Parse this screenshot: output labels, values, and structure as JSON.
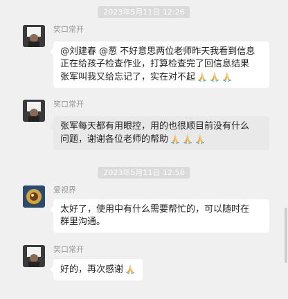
{
  "messages": [
    {
      "timestamp": "2023年5月11日 12:26"
    },
    {
      "sender": "笑口常开",
      "lines": [
        "@刘建春 @葱 不好意思两位老师昨天我看到信息",
        "正在给孩子检查作业，打算检查完了回信息结果",
        "张军叫我又给忘记了，实在对不起"
      ],
      "trailing_emoji": [
        "pray-icon",
        "pray-icon",
        "pray-icon"
      ]
    },
    {
      "sender": "笑口常开",
      "lines": [
        "张军每天都有用眼控，用的也很顺目前没有什么",
        "问题，谢谢各位老师的帮助"
      ],
      "trailing_emoji": [
        "pray-icon",
        "pray-icon",
        "pray-icon"
      ]
    },
    {
      "timestamp": "2023年5月11日 12:58"
    },
    {
      "sender": "爱视界",
      "lines": [
        "太好了，使用中有什么需要帮忙的，可以随时在",
        "群里沟通。"
      ]
    },
    {
      "sender": "笑口常开",
      "lines": [
        "好的，再次感谢"
      ],
      "trailing_emoji": [
        "pray-icon"
      ]
    }
  ],
  "colors": {
    "background": "#f0f0f0",
    "bubble": "#ffffff",
    "bubble_hover": "#e9e9e9",
    "timestamp_bg": "#dadada",
    "name": "#9a9a9a"
  }
}
